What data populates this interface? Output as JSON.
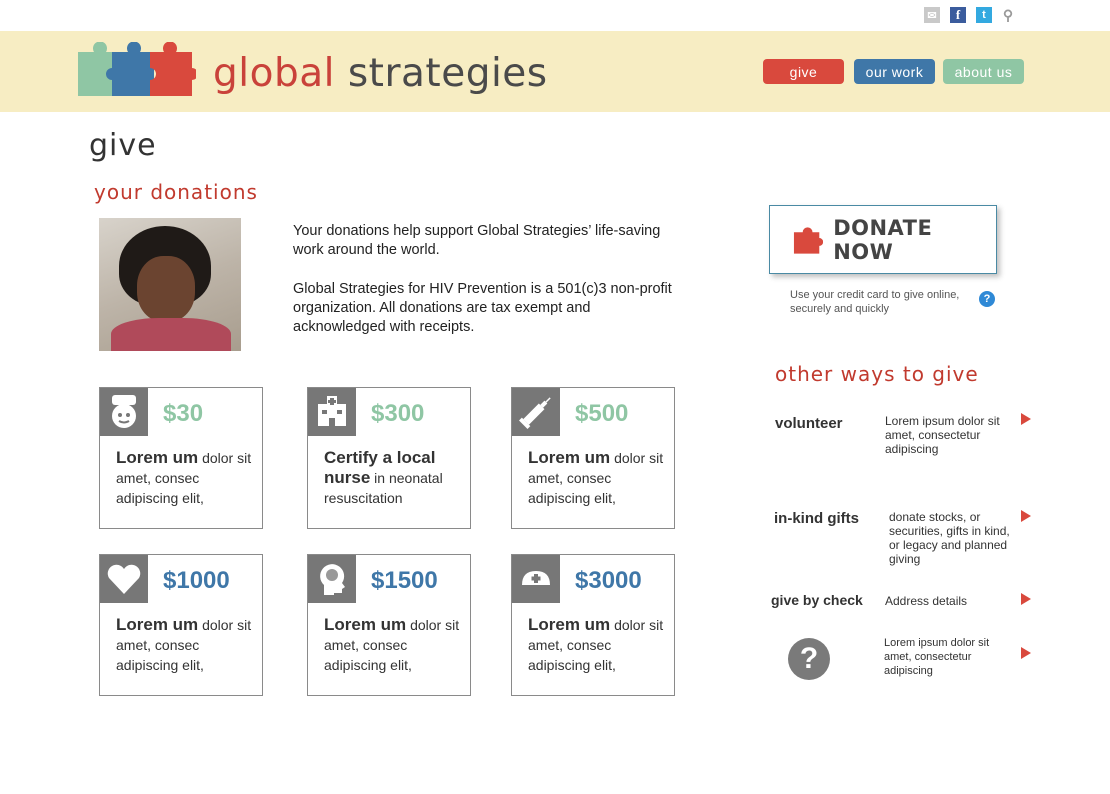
{
  "utility": {
    "icons": [
      "mail-icon",
      "facebook-icon",
      "twitter-icon",
      "search-icon"
    ],
    "fb_glyph": "f",
    "tw_glyph": "t",
    "search_glyph": "⚲",
    "mail_glyph": "✉"
  },
  "header": {
    "logo_word1": "global",
    "logo_word2": "strategies",
    "nav": {
      "give": "give",
      "our_work": "our work",
      "about_us": "about us"
    }
  },
  "colors": {
    "header_bg": "#f7edc3",
    "red": "#d9493d",
    "blue": "#3f77a8",
    "green": "#8fc6a4"
  },
  "page": {
    "title": "give",
    "donations_heading": "your donations",
    "intro_p1": "Your donations help support Global Strategies’ life-saving work around the world.",
    "intro_p2": "Global Strategies for HIV Prevention is a 501(c)3 non-profit organization. All donations are tax exempt and acknowledged with receipts."
  },
  "cards": [
    {
      "icon": "nurse-icon",
      "amount": "$30",
      "bold": "Lorem um",
      "rest": " dolor sit amet, consec adipiscing elit,"
    },
    {
      "icon": "hospital-icon",
      "amount": "$300",
      "bold": "Certify a local nurse",
      "rest": " in neonatal resuscitation"
    },
    {
      "icon": "syringe-icon",
      "amount": "$500",
      "bold": "Lorem um",
      "rest": " dolor sit amet, consec adipiscing elit,"
    },
    {
      "icon": "heart-icon",
      "amount": "$1000",
      "bold": "Lorem um",
      "rest": " dolor sit amet, consec adipiscing elit,"
    },
    {
      "icon": "head-profile-icon",
      "amount": "$1500",
      "bold": "Lorem um",
      "rest": " dolor sit amet, consec adipiscing elit,"
    },
    {
      "icon": "nurse-cap-icon",
      "amount": "$3000",
      "bold": "Lorem um",
      "rest": " dolor sit amet, consec adipiscing elit,"
    }
  ],
  "donate": {
    "label": "DONATE NOW",
    "credit_note": "Use your credit card to give online, securely and quickly",
    "help_glyph": "?"
  },
  "other_ways": {
    "heading": "other ways to give",
    "items": [
      {
        "title": "volunteer",
        "desc": "Lorem ipsum dolor sit amet, consectetur adipiscing"
      },
      {
        "title": "in-kind gifts",
        "desc": "donate stocks, or securities, gifts in kind, or legacy and planned giving"
      },
      {
        "title": "give by check",
        "desc": "Address details"
      },
      {
        "title": "",
        "desc": "Lorem ipsum dolor sit amet, consectetur adipiscing"
      }
    ],
    "question_glyph": "?"
  }
}
